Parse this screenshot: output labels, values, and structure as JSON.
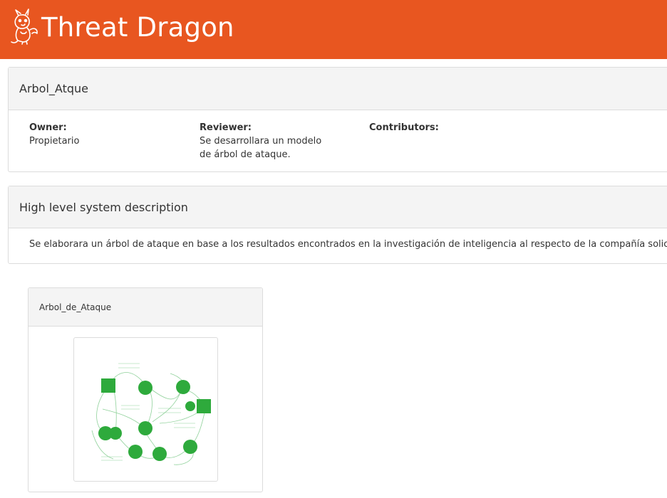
{
  "app": {
    "title": "Threat Dragon"
  },
  "model": {
    "title": "Arbol_Atque",
    "owner_label": "Owner:",
    "owner": "Propietario",
    "reviewer_label": "Reviewer:",
    "reviewer": "Se desarrollara un modelo de árbol de ataque.",
    "contributors_label": "Contributors:",
    "contributors": ""
  },
  "description": {
    "title": "High level system description",
    "text": "Se elaborara un árbol de ataque en base a los resultados encontrados en la investigación de inteligencia al respecto de la compañía solicitada."
  },
  "diagrams": [
    {
      "title": "Arbol_de_Ataque"
    }
  ],
  "colors": {
    "brand": "#e85620",
    "diagram_green": "#2eaa3c",
    "panel_bg": "#f4f4f4"
  }
}
